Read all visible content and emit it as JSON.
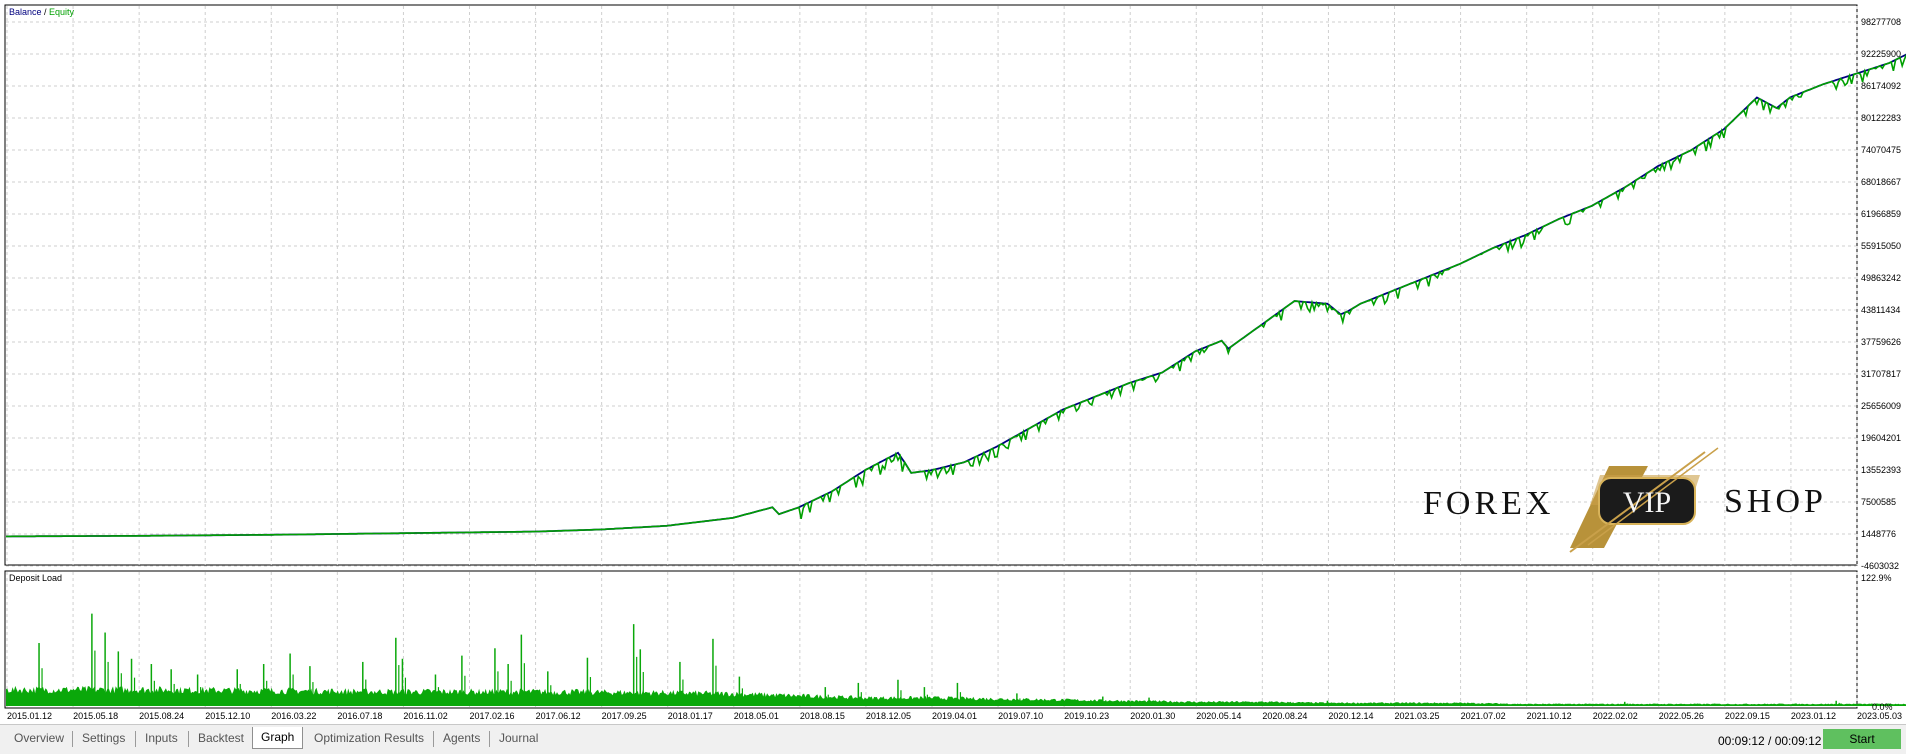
{
  "window": {
    "tabs": [
      {
        "label": "Overview",
        "active": false
      },
      {
        "label": "Settings",
        "active": false
      },
      {
        "label": "Inputs",
        "active": false
      },
      {
        "label": "Backtest",
        "active": false
      },
      {
        "label": "Graph",
        "active": true
      },
      {
        "label": "Optimization Results",
        "active": false
      },
      {
        "label": "Agents",
        "active": false
      },
      {
        "label": "Journal",
        "active": false
      }
    ],
    "timer": "00:09:12 / 00:09:12",
    "start_label": "Start",
    "start_color": "#5fc05f"
  },
  "watermark": {
    "left_text": "FOREX",
    "badge_text": "VIP",
    "right_text": "SHOP"
  },
  "chart_data": [
    {
      "type": "line",
      "legend": {
        "balance_label": "Balance",
        "separator": " / ",
        "equity_label": "Equity",
        "position": "top-left"
      },
      "y_ticks": [
        "98277708",
        "92225900",
        "86174092",
        "80122283",
        "74070475",
        "68018667",
        "61966859",
        "55915050",
        "49863242",
        "43811434",
        "37759626",
        "31707817",
        "25656009",
        "19604201",
        "13552393",
        "7500585",
        "1448776",
        "-4603032"
      ],
      "ylim": [
        -4603032,
        98277708
      ],
      "x_ticks": [
        "2015.01.12",
        "2015.05.18",
        "2015.08.24",
        "2015.12.10",
        "2016.03.22",
        "2016.07.18",
        "2016.11.02",
        "2017.02.16",
        "2017.06.12",
        "2017.09.25",
        "2018.01.17",
        "2018.05.01",
        "2018.08.15",
        "2018.12.05",
        "2019.04.01",
        "2019.07.10",
        "2019.10.23",
        "2020.01.30",
        "2020.05.14",
        "2020.08.24",
        "2020.12.14",
        "2021.03.25",
        "2021.07.02",
        "2021.10.12",
        "2022.02.02",
        "2022.05.26",
        "2022.09.15",
        "2023.01.12",
        "2023.05.03"
      ],
      "grid": true,
      "series": [
        {
          "name": "Balance",
          "color": "#00007f",
          "x": [
            0,
            2,
            4,
            6,
            8,
            9,
            10,
            11,
            11.6,
            11.7,
            12,
            12.5,
            13,
            13.5,
            13.6,
            13.7,
            14,
            14.5,
            15,
            15.5,
            16,
            16.5,
            17,
            17.5,
            18,
            18.3,
            18.4,
            18.5,
            19,
            19.5,
            20,
            20.2,
            20.3,
            20.5,
            21,
            21.5,
            22,
            22.5,
            23,
            23.5,
            24,
            24.5,
            25,
            25.5,
            26,
            26.5,
            26.8,
            26.9,
            27,
            27.5,
            28,
            28.5,
            28.9
          ],
          "values": [
            1000000,
            1100000,
            1300000,
            1600000,
            1900000,
            2300000,
            3000000,
            4500000,
            6500000,
            5200000,
            6500000,
            9500000,
            13500000,
            16800000,
            15000000,
            13000000,
            13500000,
            15000000,
            18000000,
            21500000,
            25000000,
            27500000,
            30000000,
            32000000,
            36000000,
            37500000,
            38000000,
            36500000,
            41000000,
            45500000,
            45000000,
            43000000,
            43500000,
            45000000,
            47500000,
            50000000,
            52500000,
            55500000,
            58000000,
            61000000,
            63500000,
            67000000,
            71000000,
            74000000,
            78000000,
            84000000,
            82000000,
            83000000,
            84000000,
            86500000,
            88500000,
            90500000,
            93000000
          ]
        },
        {
          "name": "Equity",
          "color": "#00a000",
          "note_same_as_balance_with_dips": true
        }
      ]
    },
    {
      "type": "area",
      "legend": {
        "label": "Deposit Load",
        "position": "top-left"
      },
      "y_ticks": [
        "122.9%",
        "0.0%"
      ],
      "ylim": [
        0,
        122.9
      ],
      "color": "#0aa80a",
      "baseline_profile": [
        [
          0,
          16
        ],
        [
          2,
          16
        ],
        [
          4,
          15
        ],
        [
          6,
          14
        ],
        [
          8,
          14
        ],
        [
          10,
          13
        ],
        [
          11,
          12
        ],
        [
          12,
          10
        ],
        [
          13,
          8
        ],
        [
          14,
          8
        ],
        [
          15,
          7
        ],
        [
          16,
          6
        ],
        [
          17,
          5
        ],
        [
          18,
          4
        ],
        [
          19,
          4
        ],
        [
          20,
          3
        ],
        [
          21,
          3
        ],
        [
          22,
          3
        ],
        [
          23,
          2
        ],
        [
          24,
          2
        ],
        [
          25,
          2
        ],
        [
          26,
          2
        ],
        [
          27,
          2
        ],
        [
          28,
          2
        ],
        [
          28.9,
          2
        ]
      ],
      "spikes": [
        [
          0.5,
          60
        ],
        [
          1.3,
          88
        ],
        [
          1.5,
          70
        ],
        [
          1.7,
          52
        ],
        [
          1.9,
          45
        ],
        [
          2.2,
          40
        ],
        [
          2.5,
          35
        ],
        [
          2.9,
          30
        ],
        [
          3.5,
          35
        ],
        [
          3.9,
          40
        ],
        [
          4.3,
          50
        ],
        [
          4.6,
          38
        ],
        [
          5.4,
          42
        ],
        [
          5.9,
          65
        ],
        [
          6.0,
          45
        ],
        [
          6.5,
          30
        ],
        [
          6.9,
          48
        ],
        [
          7.4,
          55
        ],
        [
          7.6,
          40
        ],
        [
          7.8,
          68
        ],
        [
          8.2,
          33
        ],
        [
          8.8,
          46
        ],
        [
          9.5,
          78
        ],
        [
          9.6,
          54
        ],
        [
          10.2,
          42
        ],
        [
          10.7,
          64
        ],
        [
          11.1,
          28
        ],
        [
          12.4,
          18
        ],
        [
          12.9,
          22
        ],
        [
          13.5,
          25
        ],
        [
          13.9,
          18
        ],
        [
          14.4,
          22
        ],
        [
          15.3,
          12
        ],
        [
          16.6,
          9
        ],
        [
          17.3,
          8
        ],
        [
          20.0,
          5
        ],
        [
          24.5,
          4
        ],
        [
          27.7,
          5
        ]
      ]
    }
  ]
}
